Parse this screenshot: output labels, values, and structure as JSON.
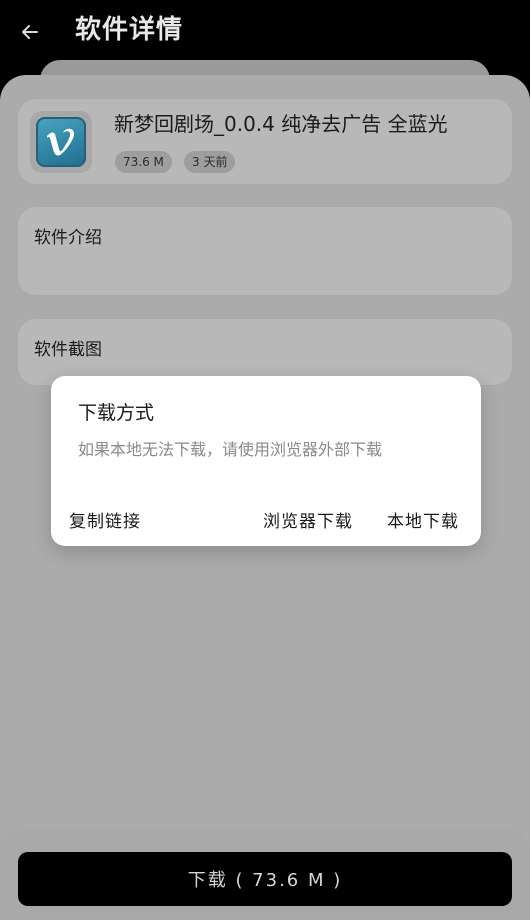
{
  "header": {
    "title": "软件详情",
    "back_icon": "arrow-left-icon"
  },
  "app": {
    "name": "新梦回剧场_0.0.4 纯净去广告 全蓝光",
    "size": "73.6 M",
    "updated": "3 天前",
    "icon": "vimeo-icon",
    "icon_color": "#2d86a8"
  },
  "sections": {
    "intro_title": "软件介绍",
    "screenshots_title": "软件截图"
  },
  "dialog": {
    "title": "下载方式",
    "message": "如果本地无法下载，请使用浏览器外部下载",
    "copy_link": "复制链接",
    "browser_download": "浏览器下载",
    "local_download": "本地下载"
  },
  "footer": {
    "download_label": "下载 ( 73.6 M )"
  },
  "colors": {
    "overlay": "#ababab",
    "card": "#b8b8b8",
    "primary_button": "#000000"
  }
}
